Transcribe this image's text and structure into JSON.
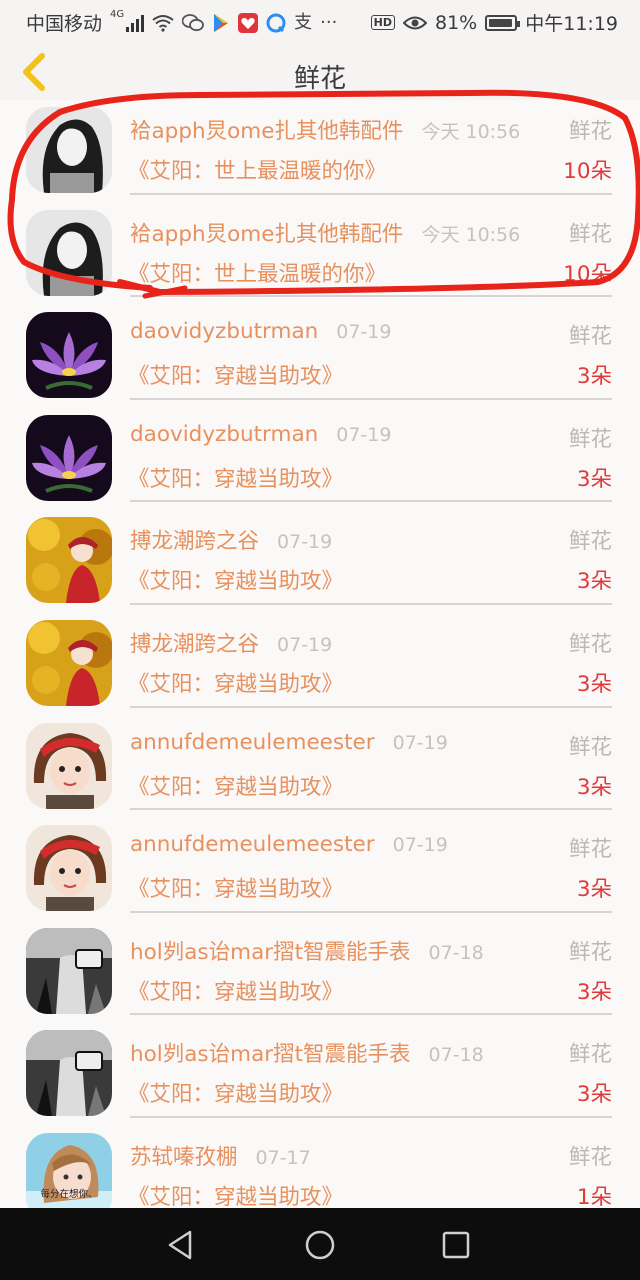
{
  "status_bar": {
    "carrier": "中国移动",
    "network": "4G",
    "hd": "HD",
    "battery_percent": "81%",
    "battery_level": 0.81,
    "time": "中午11:19",
    "more": "···",
    "pay_glyph": "支",
    "icons": [
      "signal-icon",
      "wifi-icon",
      "wechat-icon",
      "play-store-icon",
      "app-icon",
      "qq-browser-icon",
      "alipay-icon",
      "eye-icon",
      "battery-icon"
    ]
  },
  "nav": {
    "title": "鲜花",
    "back_icon": "chevron-left-icon"
  },
  "items": [
    {
      "user": "袷apph炅ome扎其他韩配件",
      "time": "今天 10:56",
      "gift": "鲜花",
      "book": "《艾阳：世上最温暖的你》",
      "count": "10朵",
      "avatar": "bw-girl"
    },
    {
      "user": "袷apph炅ome扎其他韩配件",
      "time": "今天 10:56",
      "gift": "鲜花",
      "book": "《艾阳：世上最温暖的你》",
      "count": "10朵",
      "avatar": "bw-girl"
    },
    {
      "user": "daovidyzbutrman",
      "time": "07-19",
      "gift": "鲜花",
      "book": "《艾阳：穿越当助攻》",
      "count": "3朵",
      "avatar": "lotus"
    },
    {
      "user": "daovidyzbutrman",
      "time": "07-19",
      "gift": "鲜花",
      "book": "《艾阳：穿越当助攻》",
      "count": "3朵",
      "avatar": "lotus"
    },
    {
      "user": "搏龙潮跨之谷",
      "time": "07-19",
      "gift": "鲜花",
      "book": "《艾阳：穿越当助攻》",
      "count": "3朵",
      "avatar": "autumn"
    },
    {
      "user": "搏龙潮跨之谷",
      "time": "07-19",
      "gift": "鲜花",
      "book": "《艾阳：穿越当助攻》",
      "count": "3朵",
      "avatar": "autumn"
    },
    {
      "user": "annufdemeulemeester",
      "time": "07-19",
      "gift": "鲜花",
      "book": "《艾阳：穿越当助攻》",
      "count": "3朵",
      "avatar": "redhair"
    },
    {
      "user": "annufdemeulemeester",
      "time": "07-19",
      "gift": "鲜花",
      "book": "《艾阳：穿越当助攻》",
      "count": "3朵",
      "avatar": "redhair"
    },
    {
      "user": "hol刿as诒mar摺t智震能手表",
      "time": "07-18",
      "gift": "鲜花",
      "book": "《艾阳：穿越当助攻》",
      "count": "3朵",
      "avatar": "bw-photo"
    },
    {
      "user": "hol刿as诒mar摺t智震能手表",
      "time": "07-18",
      "gift": "鲜花",
      "book": "《艾阳：穿越当助攻》",
      "count": "3朵",
      "avatar": "bw-photo"
    },
    {
      "user": "苏轼嗪孜棚",
      "time": "07-17",
      "gift": "鲜花",
      "book": "《艾阳：穿越当助攻》",
      "count": "1朵",
      "avatar": "blue-girl",
      "avatar_caption": "每分在想你、"
    }
  ],
  "system_nav": {
    "back": "back-triangle-icon",
    "home": "home-circle-icon",
    "recents": "recents-square-icon"
  },
  "colors": {
    "accent": "#e6915e",
    "count": "#e03a3a",
    "annotation": "#e8231a"
  }
}
